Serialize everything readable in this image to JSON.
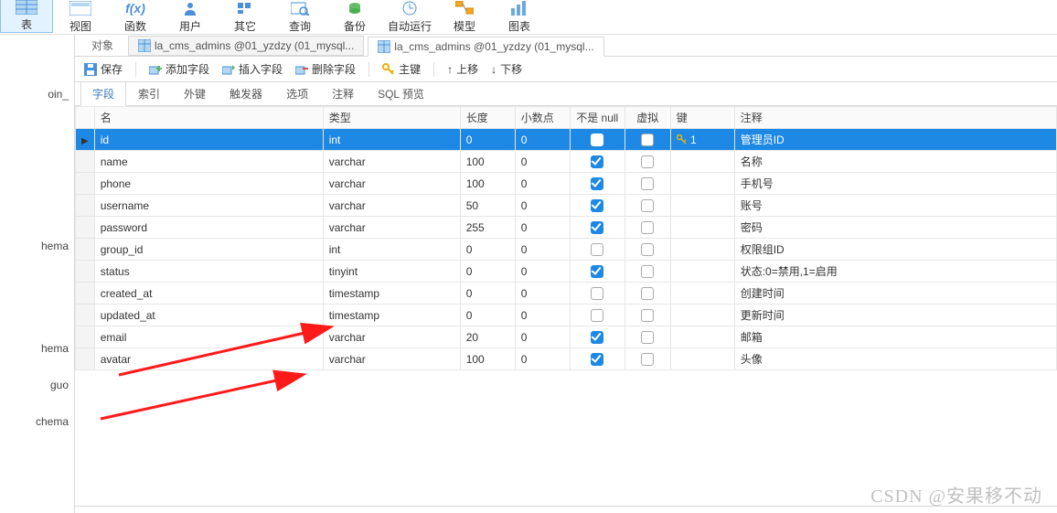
{
  "ribbon": [
    {
      "key": "table",
      "label": "表"
    },
    {
      "key": "view",
      "label": "视图"
    },
    {
      "key": "fx",
      "label": "函数"
    },
    {
      "key": "user",
      "label": "用户"
    },
    {
      "key": "other",
      "label": "其它"
    },
    {
      "key": "query",
      "label": "查询"
    },
    {
      "key": "backup",
      "label": "备份"
    },
    {
      "key": "auto",
      "label": "自动运行"
    },
    {
      "key": "model",
      "label": "模型"
    },
    {
      "key": "chart",
      "label": "图表"
    }
  ],
  "sidebar": {
    "items": [
      "oin_",
      "hema",
      "hema",
      "guo",
      "chema"
    ]
  },
  "tabs": {
    "object_label": "对象",
    "files": [
      {
        "label": "la_cms_admins @01_yzdzy (01_mysql...",
        "active": false
      },
      {
        "label": "la_cms_admins @01_yzdzy (01_mysql...",
        "active": true
      }
    ]
  },
  "toolbar": {
    "save": "保存",
    "add_field": "添加字段",
    "insert_field": "插入字段",
    "delete_field": "删除字段",
    "primary_key": "主键",
    "move_up": "上移",
    "move_down": "下移"
  },
  "subtabs": [
    "字段",
    "索引",
    "外键",
    "触发器",
    "选项",
    "注释",
    "SQL 预览"
  ],
  "columns": {
    "name": "名",
    "type": "类型",
    "length": "长度",
    "decimals": "小数点",
    "notnull": "不是 null",
    "virtual": "虚拟",
    "key": "键",
    "comment": "注释"
  },
  "rows": [
    {
      "name": "id",
      "type": "int",
      "length": "0",
      "decimals": "0",
      "notnull": true,
      "virtual": false,
      "key": "1",
      "comment": "管理员ID",
      "selected": true
    },
    {
      "name": "name",
      "type": "varchar",
      "length": "100",
      "decimals": "0",
      "notnull": true,
      "virtual": false,
      "key": "",
      "comment": "名称"
    },
    {
      "name": "phone",
      "type": "varchar",
      "length": "100",
      "decimals": "0",
      "notnull": true,
      "virtual": false,
      "key": "",
      "comment": "手机号"
    },
    {
      "name": "username",
      "type": "varchar",
      "length": "50",
      "decimals": "0",
      "notnull": true,
      "virtual": false,
      "key": "",
      "comment": "账号"
    },
    {
      "name": "password",
      "type": "varchar",
      "length": "255",
      "decimals": "0",
      "notnull": true,
      "virtual": false,
      "key": "",
      "comment": "密码"
    },
    {
      "name": "group_id",
      "type": "int",
      "length": "0",
      "decimals": "0",
      "notnull": false,
      "virtual": false,
      "key": "",
      "comment": "权限组ID"
    },
    {
      "name": "status",
      "type": "tinyint",
      "length": "0",
      "decimals": "0",
      "notnull": true,
      "virtual": false,
      "key": "",
      "comment": "状态:0=禁用,1=启用"
    },
    {
      "name": "created_at",
      "type": "timestamp",
      "length": "0",
      "decimals": "0",
      "notnull": false,
      "virtual": false,
      "key": "",
      "comment": "创建时间"
    },
    {
      "name": "updated_at",
      "type": "timestamp",
      "length": "0",
      "decimals": "0",
      "notnull": false,
      "virtual": false,
      "key": "",
      "comment": "更新时间"
    },
    {
      "name": "email",
      "type": "varchar",
      "length": "20",
      "decimals": "0",
      "notnull": true,
      "virtual": false,
      "key": "",
      "comment": "邮箱"
    },
    {
      "name": "avatar",
      "type": "varchar",
      "length": "100",
      "decimals": "0",
      "notnull": true,
      "virtual": false,
      "key": "",
      "comment": "头像"
    }
  ],
  "watermark": "CSDN @安果移不动"
}
